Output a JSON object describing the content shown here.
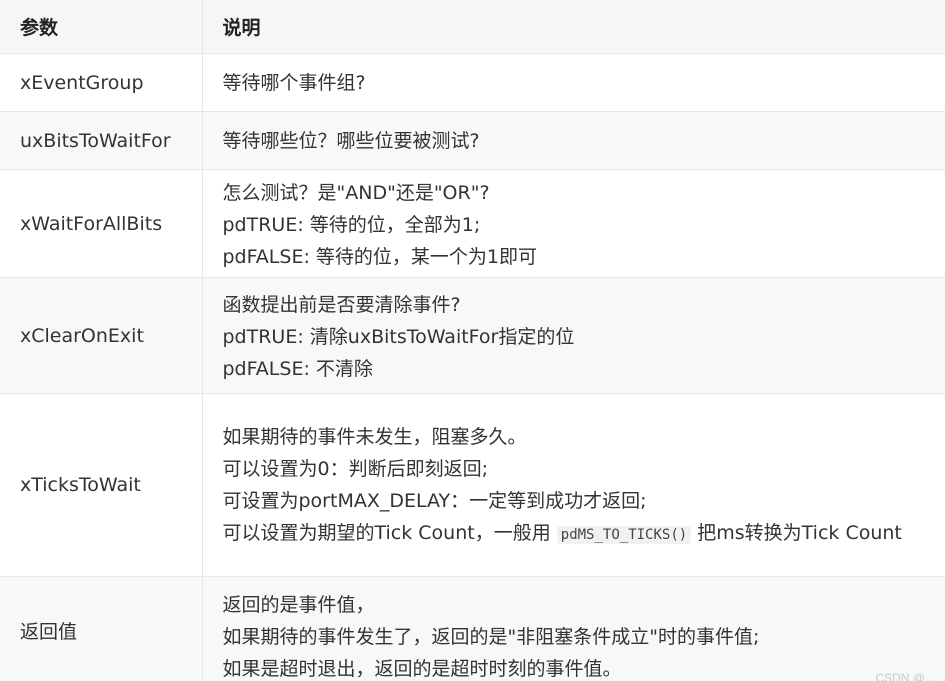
{
  "table": {
    "headers": [
      "参数",
      "说明"
    ],
    "rows": [
      {
        "param": "xEventGroup",
        "lines": [
          "等待哪个事件组?"
        ]
      },
      {
        "param": "uxBitsToWaitFor",
        "lines": [
          "等待哪些位？哪些位要被测试?"
        ]
      },
      {
        "param": "xWaitForAllBits",
        "lines": [
          "怎么测试？是\"AND\"还是\"OR\"?",
          "pdTRUE: 等待的位，全部为1;",
          "pdFALSE: 等待的位，某一个为1即可"
        ]
      },
      {
        "param": "xClearOnExit",
        "lines": [
          "函数提出前是否要清除事件?",
          "pdTRUE: 清除uxBitsToWaitFor指定的位",
          "pdFALSE: 不清除"
        ]
      },
      {
        "param": "xTicksToWait",
        "lines": [
          "如果期待的事件未发生，阻塞多久。",
          "可以设置为0：判断后即刻返回;",
          "可设置为portMAX_DELAY：一定等到成功才返回;"
        ],
        "mixed": {
          "before": "可以设置为期望的Tick Count，一般用 ",
          "code": "pdMS_TO_TICKS()",
          "after": " 把ms转换为Tick Count"
        }
      },
      {
        "param": "返回值",
        "lines": [
          "返回的是事件值，",
          "如果期待的事件发生了，返回的是\"非阻塞条件成立\"时的事件值;",
          "如果是超时退出，返回的是超时时刻的事件值。"
        ]
      }
    ]
  },
  "watermark": "CSDN @..."
}
